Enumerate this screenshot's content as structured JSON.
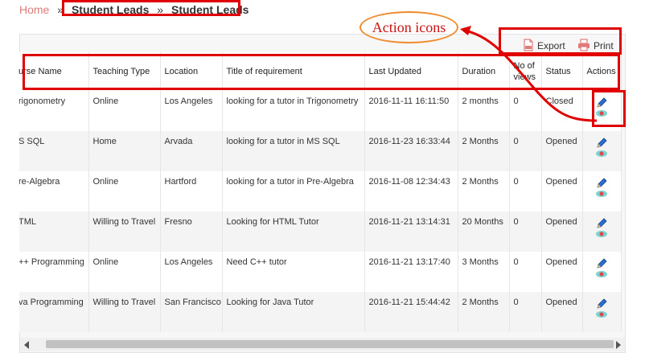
{
  "breadcrumb": {
    "home": "Home",
    "sep": "»",
    "item1": "Student Leads",
    "item2": "Student Leads"
  },
  "toolbar": {
    "export_label": "Export",
    "print_label": "Print"
  },
  "annotation": {
    "callout_text": "Action icons",
    "callout_color": "#cc1111",
    "highlight_color": "#e00000",
    "ellipse_color": "#f08a2c"
  },
  "table": {
    "headers": [
      "urse Name",
      "Teaching Type",
      "Location",
      "Title of requirement",
      "Last Updated",
      "Duration",
      "No of views",
      "Status",
      "Actions"
    ],
    "rows": [
      {
        "course": "rigonometry",
        "type": "Online",
        "location": "Los Angeles",
        "title": "looking for a tutor in Trigonometry",
        "updated": "2016-11-11 16:11:50",
        "duration": "2 months",
        "views": "0",
        "status": "Closed"
      },
      {
        "course": "S SQL",
        "type": "Home",
        "location": "Arvada",
        "title": "looking for a tutor in MS SQL",
        "updated": "2016-11-23 16:33:44",
        "duration": "2 Months",
        "views": "0",
        "status": "Opened"
      },
      {
        "course": "re-Algebra",
        "type": "Online",
        "location": "Hartford",
        "title": "looking for a tutor in Pre-Algebra",
        "updated": "2016-11-08 12:34:43",
        "duration": "2 Months",
        "views": "0",
        "status": "Opened"
      },
      {
        "course": "TML",
        "type": "Willing to Travel",
        "location": "Fresno",
        "title": "Looking for HTML Tutor",
        "updated": "2016-11-21 13:14:31",
        "duration": "20 Months",
        "views": "0",
        "status": "Opened"
      },
      {
        "course": "++ Programming",
        "type": "Online",
        "location": "Los Angeles",
        "title": "Need C++ tutor",
        "updated": "2016-11-21 13:17:40",
        "duration": "3 Months",
        "views": "0",
        "status": "Opened"
      },
      {
        "course": "va Programming",
        "type": "Willing to Travel",
        "location": "San Francisco",
        "title": "Looking for Java Tutor",
        "updated": "2016-11-21 15:44:42",
        "duration": "2 Months",
        "views": "0",
        "status": "Opened"
      }
    ],
    "action_icons": [
      "edit-pencil-icon",
      "view-eye-icon"
    ]
  }
}
